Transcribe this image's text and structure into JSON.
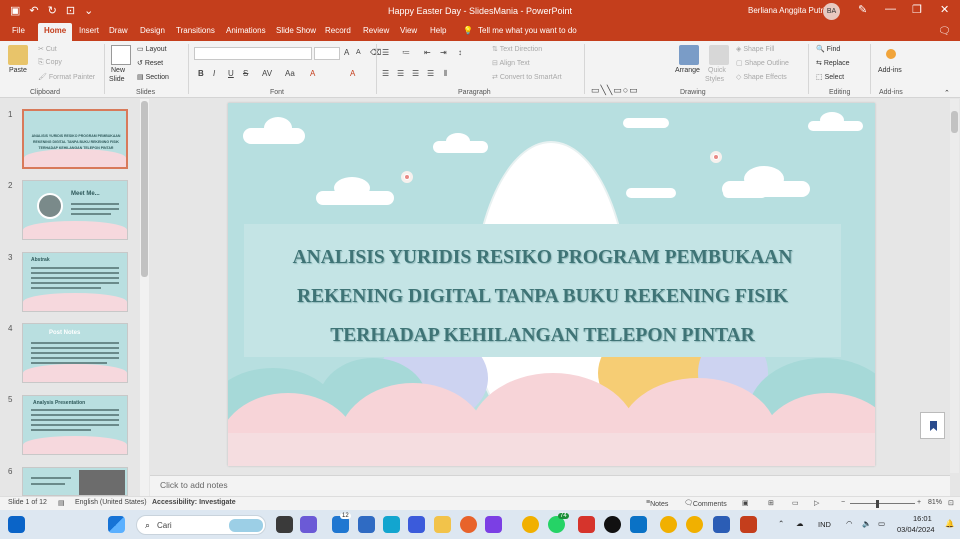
{
  "window": {
    "title": "Happy Easter Day - SlidesMania - PowerPoint",
    "user": "Berliana Anggita Putri",
    "user_initials": "BA",
    "accent": "#c43e1c"
  },
  "tabs": [
    "File",
    "Home",
    "Insert",
    "Draw",
    "Design",
    "Transitions",
    "Animations",
    "Slide Show",
    "Record",
    "Review",
    "View",
    "Help"
  ],
  "tell_me": "Tell me what you want to do",
  "ribbon": {
    "clipboard": {
      "paste": "Paste",
      "cut": "Cut",
      "copy": "Copy",
      "format_painter": "Format Painter",
      "label": "Clipboard"
    },
    "slides": {
      "new_slide": "New",
      "new_slide2": "Slide",
      "layout": "Layout",
      "reset": "Reset",
      "section": "Section",
      "label": "Slides"
    },
    "font": {
      "label": "Font",
      "bold": "B",
      "italic": "I",
      "underline": "U",
      "strike": "S",
      "grow": "A",
      "shrink": "A"
    },
    "paragraph": {
      "text_direction": "Text Direction",
      "align_text": "Align Text",
      "smartart": "Convert to SmartArt",
      "label": "Paragraph"
    },
    "drawing": {
      "arrange": "Arrange",
      "quick_styles": "Quick",
      "quick_styles2": "Styles",
      "shape_fill": "Shape Fill",
      "shape_outline": "Shape Outline",
      "shape_effects": "Shape Effects",
      "label": "Drawing"
    },
    "editing": {
      "find": "Find",
      "replace": "Replace",
      "select": "Select",
      "label": "Editing"
    },
    "addins": {
      "addins": "Add-ins",
      "label": "Add-ins"
    }
  },
  "thumbnails": [
    {
      "num": "1",
      "header": "ANALISIS YURIDIS RESIKO PROGRAM PEMBUKAAN REKENING DIGITAL TANPA BUKU REKENING FISIK TERHADAP KEHILANGAN TELEPON PINTAR"
    },
    {
      "num": "2",
      "header": "Meet Me..."
    },
    {
      "num": "3",
      "header": "Abstrak"
    },
    {
      "num": "4",
      "header": "Post Notes"
    },
    {
      "num": "5",
      "header": "Analysis Presentation"
    },
    {
      "num": "6",
      "header": ""
    }
  ],
  "slide": {
    "title_line1": "ANALISIS YURIDIS RESIKO PROGRAM PEMBUKAAN",
    "title_line2": "REKENING DIGITAL TANPA BUKU REKENING FISIK",
    "title_line3": "TERHADAP KEHILANGAN TELEPON PINTAR"
  },
  "notes_placeholder": "Click to add notes",
  "status": {
    "slide_count": "Slide 1 of 12",
    "language": "English (United States)",
    "accessibility": "Accessibility: Investigate",
    "notes": "Notes",
    "comments": "Comments",
    "zoom": "81%"
  },
  "taskbar": {
    "search_placeholder": "Cari",
    "lang": "IND",
    "time": "16:01",
    "date": "03/04/2024",
    "badge1": "12",
    "badge2": "74"
  }
}
